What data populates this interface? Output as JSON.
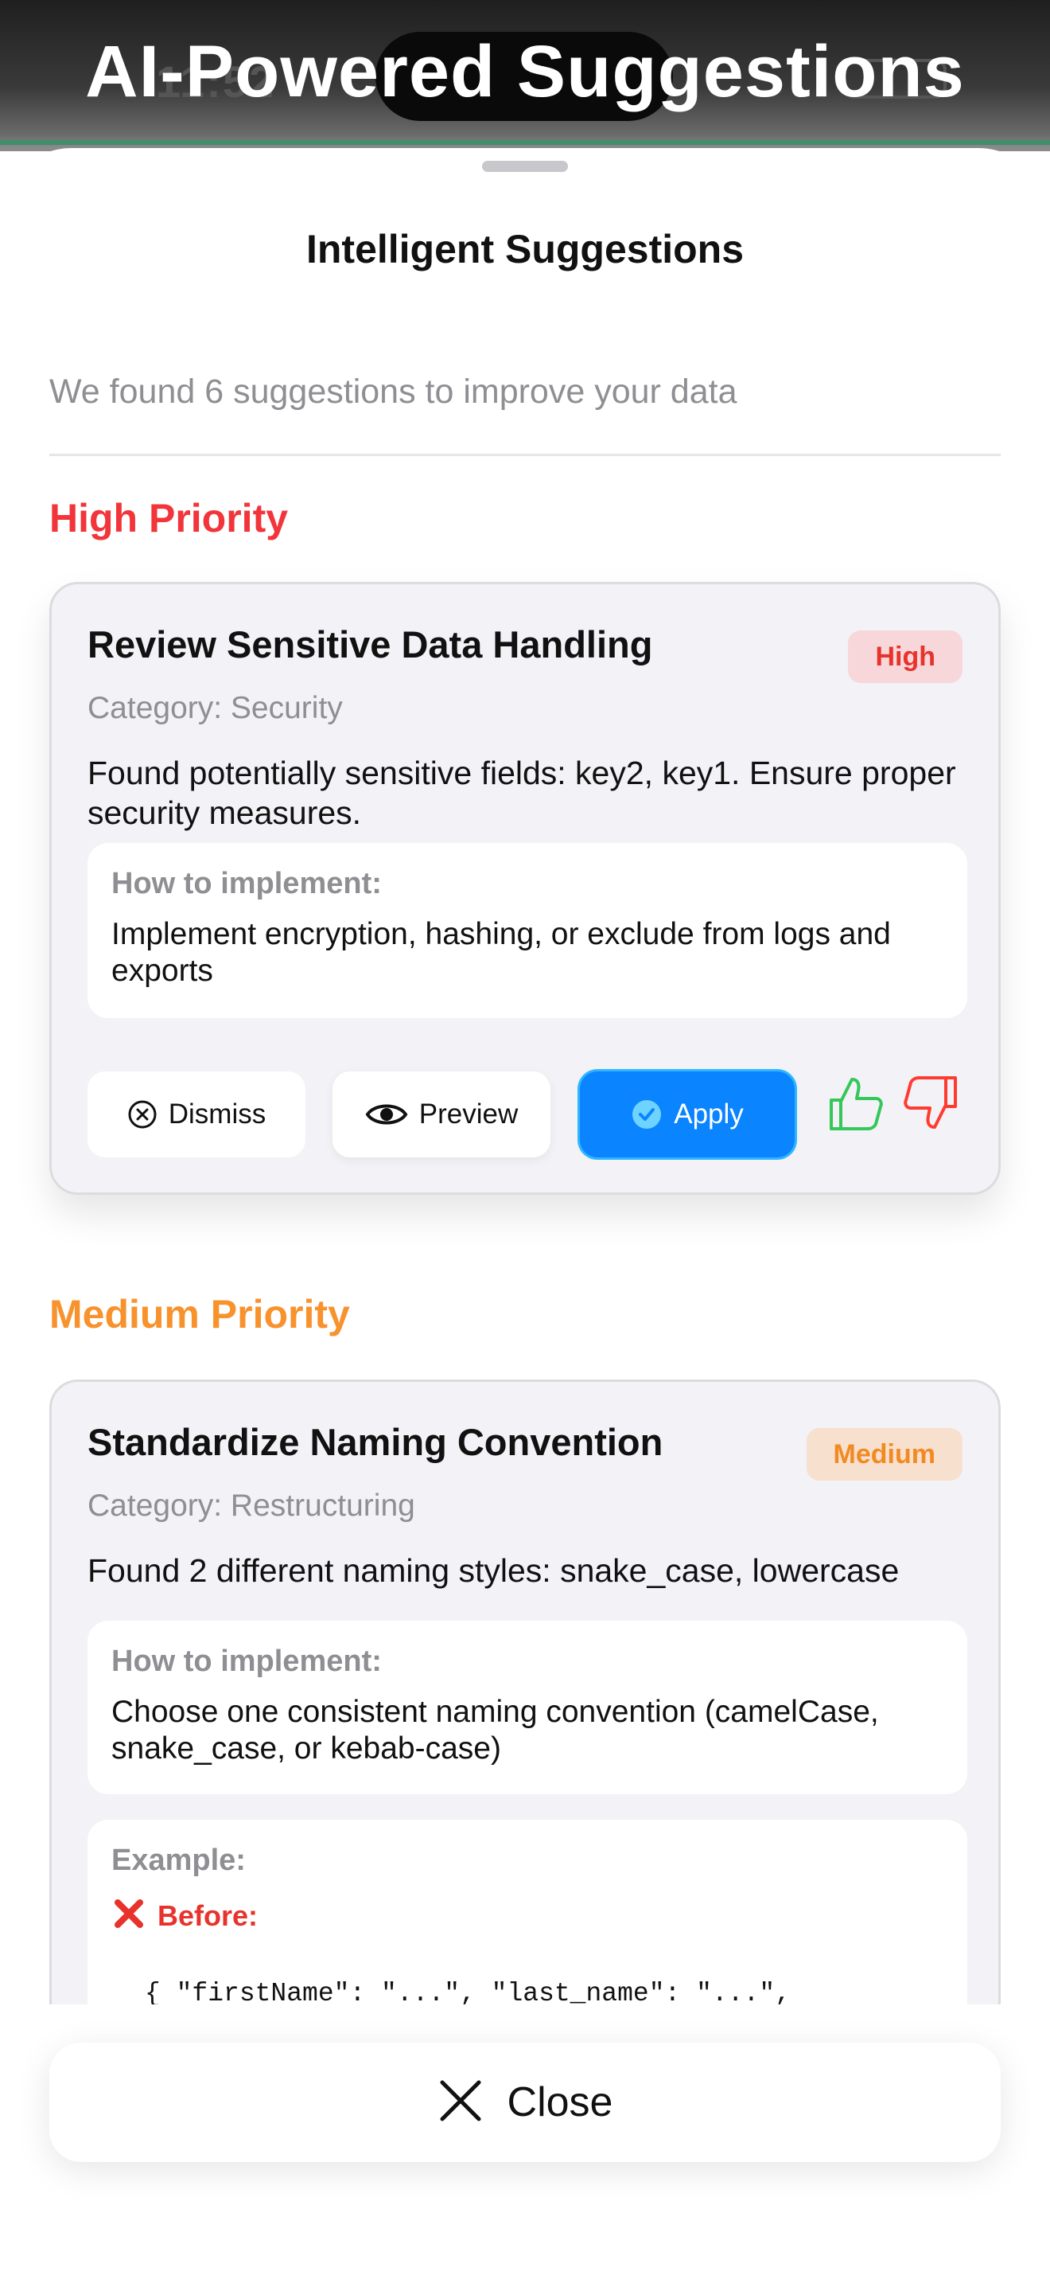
{
  "overlay": {
    "title": "AI-Powered Suggestions"
  },
  "status_bar": {
    "time": "11:52"
  },
  "sheet": {
    "title": "Intelligent Suggestions",
    "summary": "We found 6 suggestions to improve your data"
  },
  "sections": [
    {
      "title": "High Priority",
      "color": "#f2353a",
      "cards": [
        {
          "title": "Review Sensitive Data Handling",
          "badge": "High",
          "badge_color": "#e8322c",
          "badge_bg": "#f7d7da",
          "category": "Category: Security",
          "description": "Found potentially sensitive fields: key2, key1. Ensure proper security measures.",
          "how_label": "How to implement:",
          "how_text": "Implement encryption, hashing, or exclude from logs and exports",
          "actions": {
            "dismiss": {
              "label": "Dismiss",
              "icon": "x-circle-icon"
            },
            "preview": {
              "label": "Preview",
              "icon": "eye-icon"
            },
            "apply": {
              "label": "Apply",
              "icon": "check-circle-icon"
            }
          }
        }
      ]
    },
    {
      "title": "Medium Priority",
      "color": "#f7922d",
      "cards": [
        {
          "title": "Standardize Naming Convention",
          "badge": "Medium",
          "badge_color": "#f28a23",
          "badge_bg": "#f8e0ce",
          "category": "Category: Restructuring",
          "description": "Found 2 different naming styles: snake_case, lowercase",
          "how_label": "How to implement:",
          "how_text": "Choose one consistent naming convention (camelCase, snake_case, or kebab-case)",
          "example_label": "Example:",
          "before_label": "Before:",
          "before_code": "{ \"firstName\": \"...\", \"last_name\": \"...\","
        }
      ]
    }
  ],
  "footer": {
    "close_label": "Close"
  },
  "colors": {
    "accent": "#0a84ff",
    "thumbs_up": "#34c759",
    "thumbs_down": "#ff3b30"
  }
}
